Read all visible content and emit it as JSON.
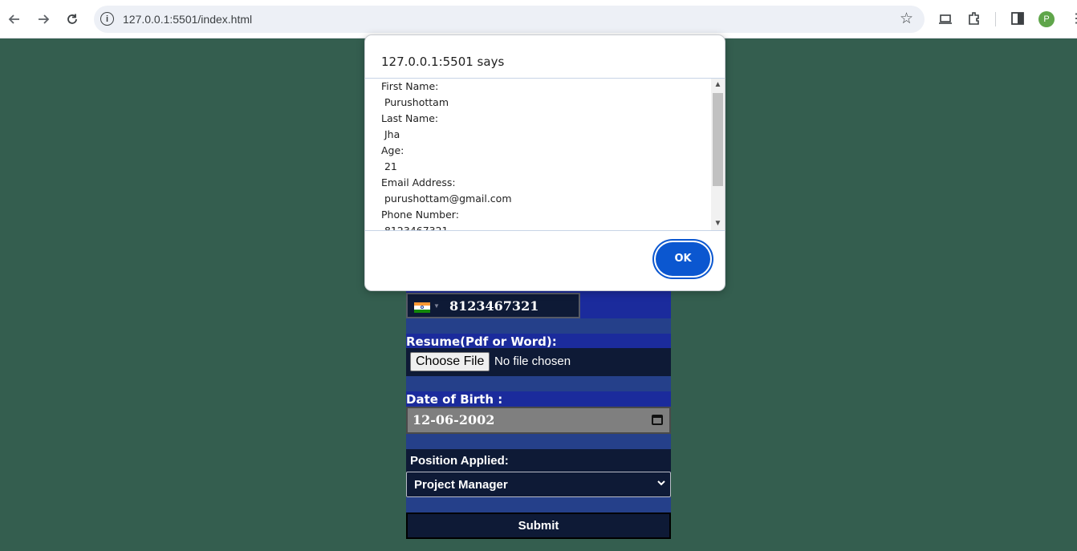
{
  "browser": {
    "url": "127.0.0.1:5501/index.html",
    "profile_initial": "P"
  },
  "dialog": {
    "title": "127.0.0.1:5501 says",
    "lines": [
      "First Name:",
      " Purushottam",
      "Last Name:",
      " Jha",
      "Age:",
      " 21",
      "Email Address:",
      " purushottam@gmail.com",
      "Phone Number:",
      " 8123467321"
    ],
    "ok_label": "OK"
  },
  "form": {
    "phone_value": "8123467321",
    "resume_label": "Resume(Pdf or Word):",
    "choose_file_label": "Choose File",
    "no_file_text": "No file chosen",
    "dob_label": "Date of Birth :",
    "dob_value": "12-06-2002",
    "position_label": "Position Applied:",
    "position_value": "Project Manager",
    "submit_label": "Submit"
  },
  "colors": {
    "page_bg": "#345e4f",
    "accent": "#0b57d0"
  }
}
